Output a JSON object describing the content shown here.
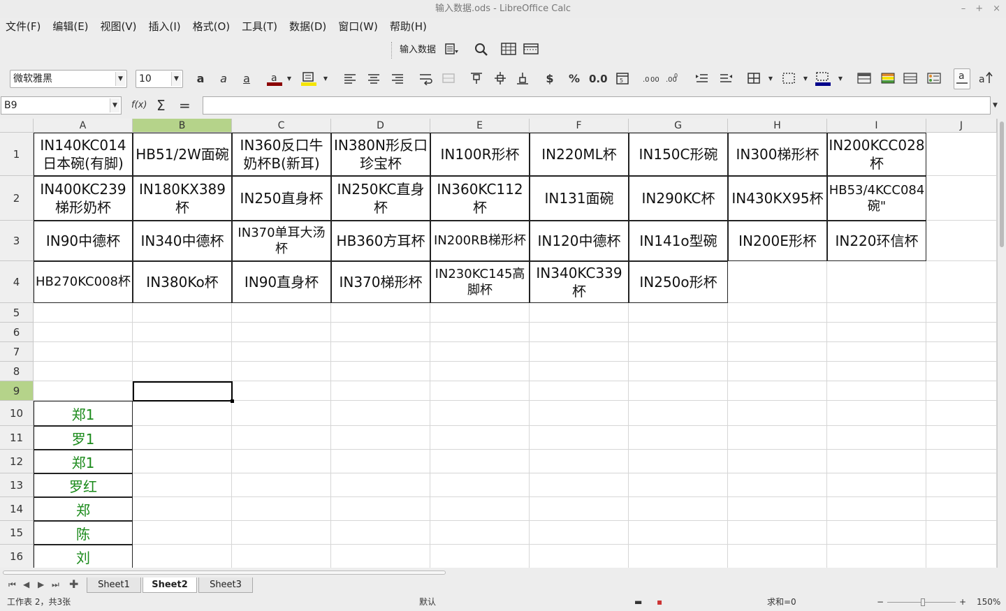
{
  "window": {
    "title": "输入数据.ods - LibreOffice Calc",
    "min": "–",
    "max": "+",
    "close": "×"
  },
  "menu": [
    "文件(F)",
    "编辑(E)",
    "视图(V)",
    "插入(I)",
    "格式(O)",
    "工具(T)",
    "数据(D)",
    "窗口(W)",
    "帮助(H)"
  ],
  "toolbar1": {
    "label": "输入数据"
  },
  "toolbar2": {
    "font_name": "微软雅黑",
    "font_size": "10",
    "currency": "$",
    "percent": "%",
    "number": "0.0",
    "fx": "f(x)",
    "sum": "Σ",
    "equals": "="
  },
  "formula_bar": {
    "name_box": "B9",
    "content": ""
  },
  "columns": [
    "A",
    "B",
    "C",
    "D",
    "E",
    "F",
    "G",
    "H",
    "I",
    "J"
  ],
  "selected_column": "B",
  "rows": [
    "1",
    "2",
    "3",
    "4",
    "5",
    "6",
    "7",
    "8",
    "9",
    "10",
    "11",
    "12",
    "13",
    "14",
    "15",
    "16"
  ],
  "selected_row": "9",
  "grid_rows": [
    [
      "IN140KC014日本碗(有脚)",
      "HB51/2W面碗",
      "IN360反口牛奶杯B(新耳)",
      "IN380N形反口珍宝杯",
      "IN100R形杯",
      "IN220ML杯",
      "IN150C形碗",
      "IN300梯形杯",
      "IN200KCC028杯"
    ],
    [
      "IN400KC239梯形奶杯",
      "IN180KX389杯",
      "IN250直身杯",
      "IN250KC直身杯",
      "IN360KC112杯",
      "IN131面碗",
      "IN290KC杯",
      "IN430KX95杯",
      "HB53/4KCC084碗\""
    ],
    [
      "IN90中德杯",
      "IN340中德杯",
      "IN370单耳大汤杯",
      "HB360方耳杯",
      "IN200RB梯形杯",
      "IN120中德杯",
      "IN141o型碗",
      "IN200E形杯",
      "IN220环信杯"
    ],
    [
      "HB270KC008杯",
      "IN380Ko杯",
      "IN90直身杯",
      "IN370梯形杯",
      "IN230KC145高脚杯",
      "IN340KC339杯",
      "IN250o形杯",
      "",
      ""
    ]
  ],
  "col_a_names": [
    "郑1",
    "罗1",
    "郑1",
    "罗红",
    "郑",
    "陈",
    "刘"
  ],
  "sheets": [
    "Sheet1",
    "Sheet2",
    "Sheet3"
  ],
  "active_sheet": "Sheet2",
  "status": {
    "sheet_info": "工作表 2，共3张",
    "page_style": "默认",
    "sum": "求和=0",
    "zoom": "150%"
  },
  "colors": {
    "selection": "#b5d38a",
    "green_text": "#1a8a1a"
  }
}
